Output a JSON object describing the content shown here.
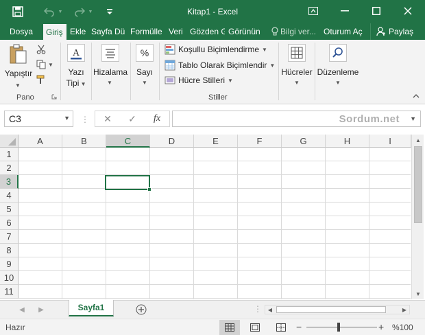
{
  "window": {
    "title": "Kitap1 - Excel"
  },
  "tabs": [
    {
      "label": "Dosya"
    },
    {
      "label": "Giriş"
    },
    {
      "label": "Ekle"
    },
    {
      "label": "Sayfa Dü"
    },
    {
      "label": "Formülle"
    },
    {
      "label": "Veri"
    },
    {
      "label": "Gözden G"
    },
    {
      "label": "Görünün"
    },
    {
      "label": "Bilgi ver..."
    },
    {
      "label": "Oturum Aç"
    },
    {
      "label": "Paylaş"
    }
  ],
  "ribbon": {
    "clipboard": {
      "paste_label": "Yapıştır",
      "group_label": "Pano"
    },
    "font": {
      "line1": "Yazı",
      "line2": "Tipi"
    },
    "alignment": {
      "label": "Hizalama"
    },
    "number": {
      "label": "Sayı"
    },
    "styles": {
      "conditional": "Koşullu Biçimlendirme",
      "as_table": "Tablo Olarak Biçimlendir",
      "cell_styles": "Hücre Stilleri",
      "group_label": "Stiller"
    },
    "cells": {
      "label": "Hücreler"
    },
    "editing": {
      "label": "Düzenleme"
    }
  },
  "formula_bar": {
    "name_box": "C3",
    "formula": "",
    "watermark": "Sordum.net"
  },
  "grid": {
    "columns": [
      "A",
      "B",
      "C",
      "D",
      "E",
      "F",
      "G",
      "H",
      "I"
    ],
    "rows": [
      "1",
      "2",
      "3",
      "4",
      "5",
      "6",
      "7",
      "8",
      "9",
      "10",
      "11"
    ],
    "selected_column": "C",
    "selected_row": "3",
    "selected_cell": "C3"
  },
  "sheets": [
    {
      "name": "Sayfa1",
      "active": true
    }
  ],
  "status": {
    "mode": "Hazır",
    "zoom": "%100",
    "zoom_value": 100
  },
  "colors": {
    "accent": "#217346",
    "ribbon_bg": "#f3f3f3"
  }
}
